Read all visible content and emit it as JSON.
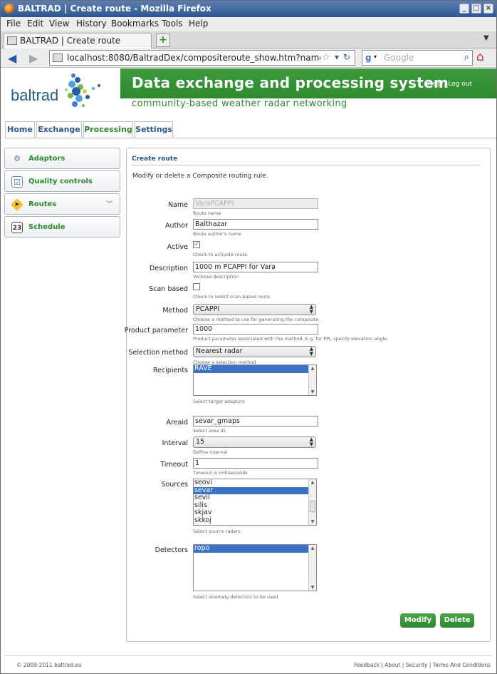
{
  "window": {
    "title": "BALTRAD | Create route - Mozilla Firefox"
  },
  "menu": [
    "File",
    "Edit",
    "View",
    "History",
    "Bookmarks",
    "Tools",
    "Help"
  ],
  "tab": {
    "label": "BALTRAD | Create route",
    "new_tab": "+"
  },
  "nav": {
    "url": "localhost:8080/BaltradDex/compositeroute_show.htm?name=Vara",
    "search_engine": "g",
    "search_placeholder": "Google"
  },
  "site": {
    "logo": "baltrad",
    "title": "Data exchange and processing system",
    "subtitle": "community-based weather radar networking",
    "help_logout": "Help | Log out",
    "tabs": [
      "Home",
      "Exchange",
      "Processing",
      "Settings"
    ],
    "active_tab": "Processing"
  },
  "sidebar": [
    {
      "label": "Adaptors",
      "icon": "gears-icon"
    },
    {
      "label": "Quality controls",
      "icon": "checklist-icon"
    },
    {
      "label": "Routes",
      "icon": "route-sign-icon"
    },
    {
      "label": "Schedule",
      "icon": "calendar-icon",
      "icon_text": "23"
    }
  ],
  "form": {
    "title": "Create route",
    "description": "Modify or delete a Composite routing rule.",
    "name": {
      "label": "Name",
      "value": "VaraPCAPPI",
      "hint": "Route name"
    },
    "author": {
      "label": "Author",
      "value": "Balthazar",
      "hint": "Route author's name"
    },
    "active": {
      "label": "Active",
      "checked": true,
      "hint": "Check to activate route"
    },
    "desc": {
      "label": "Description",
      "value": "1000 m PCAPPI for Vara",
      "hint": "Verbose description"
    },
    "scan": {
      "label": "Scan based",
      "checked": false,
      "hint": "Check to select scan-based route"
    },
    "method": {
      "label": "Method",
      "value": "PCAPPI",
      "hint": "Choose a method to use for generating the composite."
    },
    "product": {
      "label": "Product parameter",
      "value": "1000",
      "hint": "Product parameter associated with the method. E.g. for PPI, specify elevation angle."
    },
    "selection": {
      "label": "Selection method",
      "value": "Nearest radar",
      "hint": "Choose a selection method"
    },
    "recipients": {
      "label": "Recipients",
      "items": [
        "RAVE"
      ],
      "selected": "RAVE",
      "hint": "Select target adaptors"
    },
    "areaid": {
      "label": "Areaid",
      "value": "sevar_gmaps",
      "hint": "Select area ID"
    },
    "interval": {
      "label": "Interval",
      "value": "15",
      "hint": "Define interval"
    },
    "timeout": {
      "label": "Timeout",
      "value": "1",
      "hint": "Timeout in milliseconds"
    },
    "sources": {
      "label": "Sources",
      "items": [
        "seovi",
        "sevar",
        "sevil",
        "silis",
        "skjav",
        "skkoj"
      ],
      "selected": "sevar",
      "hint": "Select source radars"
    },
    "detectors": {
      "label": "Detectors",
      "items": [
        "ropo"
      ],
      "selected": "ropo",
      "hint": "Select anomaly detectors to be used"
    },
    "modify": "Modify",
    "delete": "Delete"
  },
  "footer": {
    "copyright": "© 2009-2011 baltrad.eu",
    "links": "Feedback | About | Security | Terms And Conditions"
  }
}
